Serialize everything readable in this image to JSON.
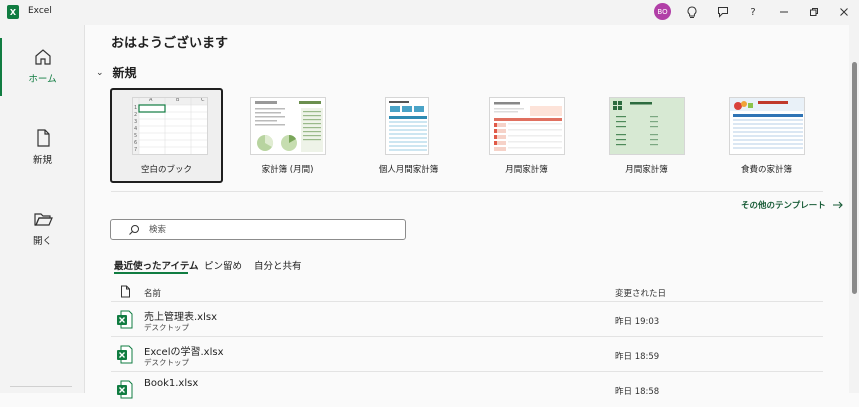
{
  "titlebar": {
    "app_name": "Excel",
    "app_icon": "excel-icon",
    "avatar_initials": "BO",
    "avatar_color": "#b13fa7",
    "icons": [
      "lightbulb-icon",
      "feedback-icon",
      "help-icon",
      "minimize-icon",
      "restore-icon",
      "close-icon"
    ],
    "help_label": "?"
  },
  "sidebar": {
    "items": [
      {
        "label": "ホーム",
        "icon": "home-icon"
      },
      {
        "label": "新規",
        "icon": "new-file-icon"
      },
      {
        "label": "開く",
        "icon": "folder-open-icon"
      }
    ]
  },
  "main": {
    "greeting": "おはようございます",
    "new_section": {
      "title": "新規",
      "templates": [
        {
          "label": "空白のブック"
        },
        {
          "label": "家計簿 (月間)"
        },
        {
          "label": "個人月間家計簿"
        },
        {
          "label": "月間家計簿"
        },
        {
          "label": "月間家計簿"
        },
        {
          "label": "食費の家計簿"
        }
      ],
      "more_link": "その他のテンプレート",
      "blank_cols": [
        "A",
        "B",
        "C"
      ],
      "blank_rows": [
        "1",
        "2",
        "3",
        "4",
        "5",
        "6",
        "7"
      ]
    },
    "search": {
      "placeholder": "検索"
    },
    "tabs": [
      {
        "label": "最近使ったアイテム"
      },
      {
        "label": "ピン留め"
      },
      {
        "label": "自分と共有"
      }
    ],
    "list": {
      "col_name": "名前",
      "col_date": "変更された日",
      "rows": [
        {
          "name": "売上管理表.xlsx",
          "location": "デスクトップ",
          "date": "昨日 19:03"
        },
        {
          "name": "Excelの学習.xlsx",
          "location": "デスクトップ",
          "date": "昨日 18:59"
        },
        {
          "name": "Book1.xlsx",
          "location": "",
          "date": "昨日 18:58"
        }
      ]
    }
  },
  "colors": {
    "accent": "#107c41",
    "link": "#185c37"
  }
}
